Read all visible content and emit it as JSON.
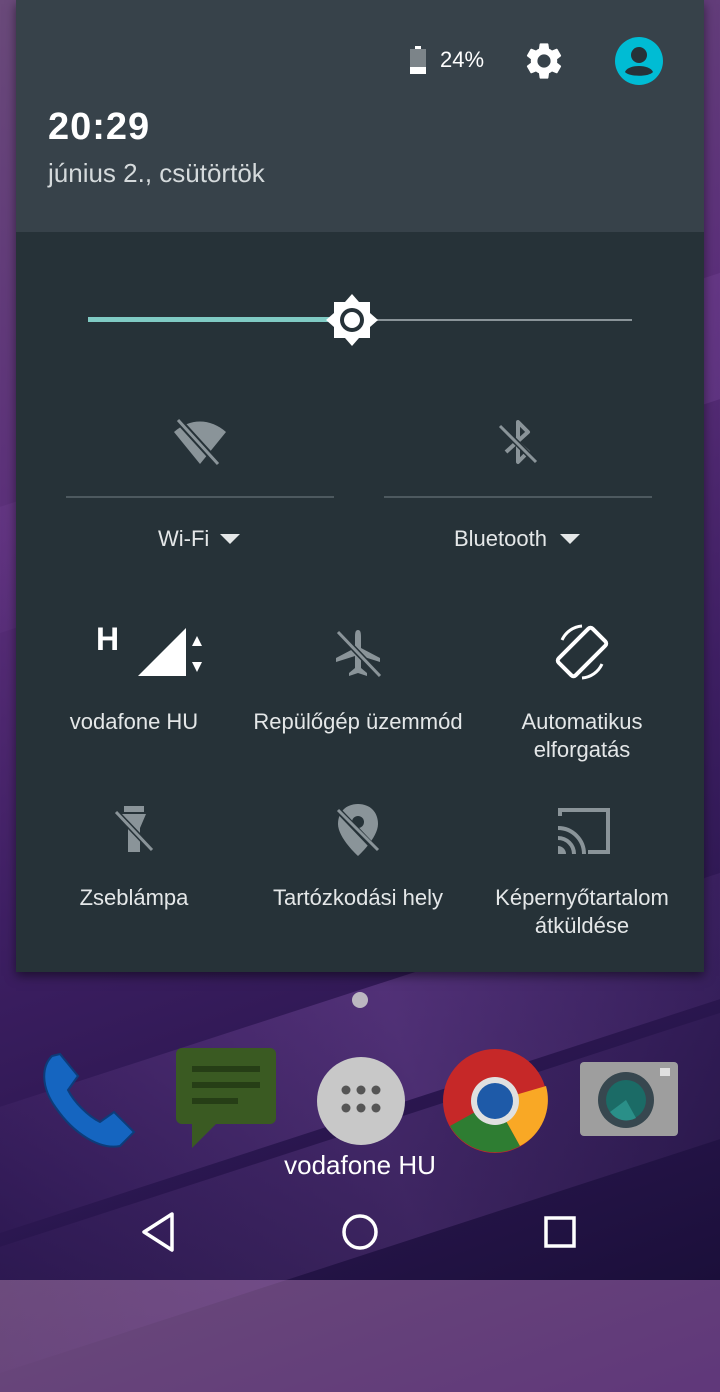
{
  "status": {
    "battery_percent": "24%",
    "battery_level": 0.24,
    "time": "20:29",
    "date": "június 2., csütörtök"
  },
  "quick_settings": {
    "brightness_level": 0.48,
    "accent_color": "#80cbc4",
    "wifi": {
      "label": "Wi-Fi",
      "icon": "wifi-off-icon"
    },
    "bluetooth": {
      "label": "Bluetooth",
      "icon": "bluetooth-off-icon"
    },
    "tiles": [
      {
        "label": "vodafone HU",
        "icon": "cellular-signal-icon",
        "network_type": "H"
      },
      {
        "label": "Repülőgép üzemmód",
        "icon": "airplane-off-icon"
      },
      {
        "label_line1": "Automatikus",
        "label_line2": "elforgatás",
        "icon": "auto-rotate-icon"
      },
      {
        "label": "Zseblámpa",
        "icon": "flashlight-off-icon"
      },
      {
        "label": "Tartózkodási hely",
        "icon": "location-off-icon"
      },
      {
        "label_line1": "Képernyőtartalom",
        "label_line2": "átküldése",
        "icon": "cast-icon"
      }
    ]
  },
  "home": {
    "carrier": "vodafone HU",
    "dock": [
      "phone-icon",
      "messages-icon",
      "app-drawer-icon",
      "chrome-icon",
      "camera-icon"
    ]
  },
  "navbar": [
    "back-icon",
    "home-icon",
    "recents-icon"
  ]
}
